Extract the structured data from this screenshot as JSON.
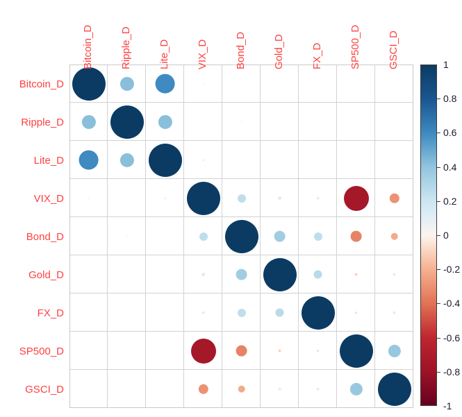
{
  "chart_data": {
    "type": "heatmap",
    "subtype": "correlation-matrix-circles",
    "title": "",
    "xlabel": "",
    "ylabel": "",
    "categories": [
      "Bitcoin_D",
      "Ripple_D",
      "Lite_D",
      "VIX_D",
      "Bond_D",
      "Gold_D",
      "FX_D",
      "SP500_D",
      "GSCI_D"
    ],
    "row_labels": [
      "Bitcoin_D",
      "Ripple_D",
      "Lite_D",
      "VIX_D",
      "Bond_D",
      "Gold_D",
      "FX_D",
      "SP500_D",
      "GSCI_D"
    ],
    "column_labels": [
      "Bitcoin_D",
      "Ripple_D",
      "Lite_D",
      "VIX_D",
      "Bond_D",
      "Gold_D",
      "FX_D",
      "SP500_D",
      "GSCI_D"
    ],
    "matrix": [
      [
        1.0,
        0.42,
        0.6,
        0.05,
        0.01,
        0.01,
        -0.02,
        -0.04,
        -0.02
      ],
      [
        0.42,
        1.0,
        0.42,
        0.01,
        0.06,
        0.03,
        0.01,
        -0.03,
        0.0
      ],
      [
        0.6,
        0.42,
        1.0,
        0.07,
        -0.02,
        -0.03,
        -0.02,
        -0.04,
        0.01
      ],
      [
        0.05,
        0.01,
        0.07,
        1.0,
        0.25,
        0.12,
        0.1,
        -0.75,
        -0.3
      ],
      [
        0.01,
        0.06,
        -0.02,
        0.25,
        1.0,
        0.35,
        0.25,
        -0.35,
        -0.22
      ],
      [
        0.01,
        0.03,
        -0.03,
        0.12,
        0.35,
        1.0,
        0.27,
        -0.1,
        0.1
      ],
      [
        -0.02,
        0.01,
        -0.02,
        0.1,
        0.25,
        0.27,
        1.0,
        -0.08,
        0.1
      ],
      [
        -0.04,
        -0.03,
        -0.04,
        -0.75,
        -0.35,
        -0.1,
        -0.08,
        1.0,
        0.38
      ],
      [
        -0.02,
        0.0,
        0.01,
        -0.3,
        -0.22,
        0.1,
        0.1,
        0.38,
        1.0
      ]
    ],
    "colorscale": {
      "min": -1,
      "max": 1,
      "ticks": [
        1,
        0.8,
        0.6,
        0.4,
        0.2,
        0,
        -0.2,
        -0.4,
        -0.6,
        -0.8,
        -1
      ],
      "tick_labels": [
        "1",
        "0.8",
        "0.6",
        "0.4",
        "0.2",
        "0",
        "-0.2",
        "-0.4",
        "-0.6",
        "-0.8",
        "-1"
      ],
      "position": "right",
      "low_color": "#67001f",
      "mid_low_color": "#d6604d",
      "mid_color": "#f7f7f7",
      "mid_high_color": "#4393c3",
      "high_color": "#0b3b63"
    },
    "label_color": "#ff4040",
    "grid": true,
    "grid_color": "#d2d2d2"
  }
}
